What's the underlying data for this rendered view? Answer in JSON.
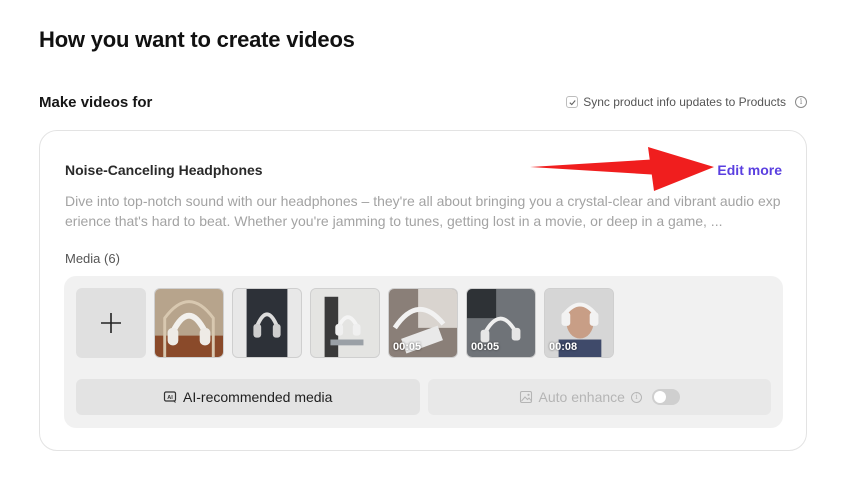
{
  "page": {
    "title": "How you want to create videos"
  },
  "section": {
    "label": "Make videos for",
    "sync_label": "Sync product info updates to Products",
    "sync_checked": true
  },
  "product": {
    "name": "Noise-Canceling Headphones",
    "edit_label": "Edit more",
    "description": "Dive into top-notch sound with our headphones – they're all about bringing you a crystal-clear and vibrant audio experience that's hard to beat. Whether you're jamming to tunes, getting lost in a movie, or deep in a game, ..."
  },
  "media": {
    "label": "Media (6)",
    "add_icon": "plus-icon",
    "items": [
      {
        "type": "image",
        "duration": ""
      },
      {
        "type": "image",
        "duration": ""
      },
      {
        "type": "image",
        "duration": ""
      },
      {
        "type": "video",
        "duration": "00:05"
      },
      {
        "type": "video",
        "duration": "00:05"
      },
      {
        "type": "video",
        "duration": "00:08"
      }
    ],
    "ai_button_label": "AI-recommended media",
    "auto_enhance_label": "Auto enhance",
    "auto_enhance_on": false
  },
  "colors": {
    "accent": "#5a3fe0",
    "annotation_arrow": "#f01e1e"
  }
}
